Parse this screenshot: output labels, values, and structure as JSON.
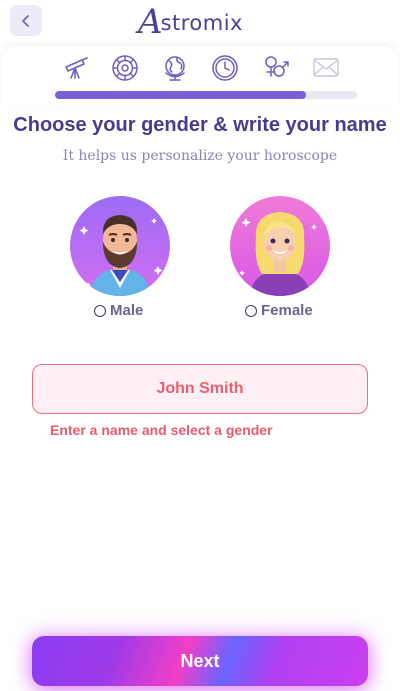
{
  "header": {
    "back_icon": "chevron-left-icon",
    "logo_initial": "A",
    "logo_rest": "stromix",
    "logo_color": "#4b3f9c"
  },
  "steps": {
    "icons": [
      "telescope-icon",
      "zodiac-wheel-icon",
      "globe-icon",
      "clock-icon",
      "gender-icon",
      "envelope-icon"
    ],
    "progress_fraction": 0.83,
    "active_color": "#7b5fd6"
  },
  "main": {
    "title": "Choose your gender & write your name",
    "subtitle": "It helps us personalize your horoscope"
  },
  "genders": [
    {
      "label": "Male",
      "avatar": "male-avatar",
      "selected": false
    },
    {
      "label": "Female",
      "avatar": "female-avatar",
      "selected": false
    }
  ],
  "form": {
    "name_placeholder": "John Smith",
    "name_value": "",
    "error": "Enter a name and select a gender",
    "error_color": "#ea5b6a"
  },
  "footer": {
    "next_label": "Next"
  }
}
